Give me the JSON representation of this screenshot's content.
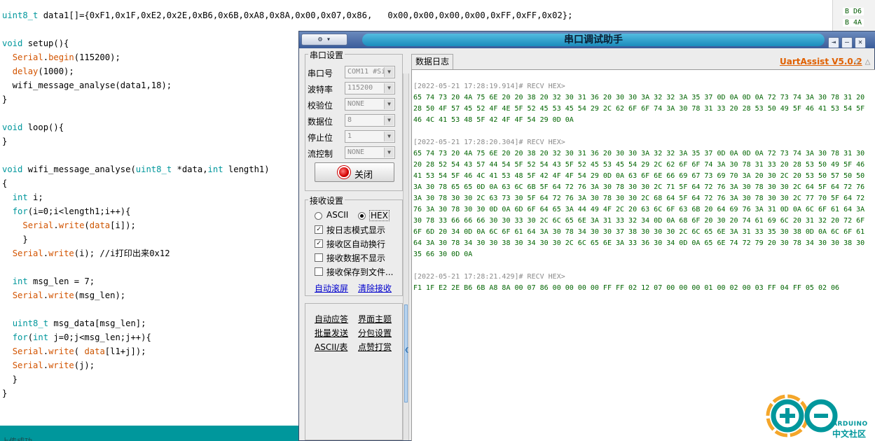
{
  "editor": {
    "top_line": "uint8_t data1[]={0xF1,0x1F,0xE2,0x2E,0xB6,0x6B,0xA8,0x8A,0x00,0x07,0x86,   0x00,0x00,0x00,0x00,0xFF,0xFF,0x02};",
    "lines": [
      "void setup(){",
      "  Serial.begin(115200);",
      "  delay(1000);",
      "  wifi_message_analyse(data1,18);",
      "}",
      "",
      "void loop(){",
      "}",
      "",
      "void wifi_message_analyse(uint8_t *data,int length1)",
      "{",
      "  int i;",
      "  for(i=0;i<length1;i++){",
      "    Serial.write(data[i]);",
      "    }",
      "  Serial.write(i); //i打印出来0x12",
      "",
      "  int msg_len = 7;",
      "  Serial.write(msg_len);",
      "",
      "  uint8_t msg_data[msg_len];",
      "  for(int j=0;j<msg_len;j++){",
      "  Serial.write( data[l1+j]);",
      "  Serial.write(j);",
      "  }",
      "}"
    ],
    "status_text": "上传成功",
    "hex_peek": [
      "B D6",
      "B 4A"
    ]
  },
  "uart": {
    "sys_menu": "⚙ ▾",
    "title": "串口调试助手",
    "title_buttons": [
      "⇥",
      "—",
      "✕"
    ],
    "port_group": "串口设置",
    "fields": [
      {
        "label": "串口号",
        "value": "COM11 #Si"
      },
      {
        "label": "波特率",
        "value": "115200"
      },
      {
        "label": "校验位",
        "value": "NONE"
      },
      {
        "label": "数据位",
        "value": "8"
      },
      {
        "label": "停止位",
        "value": "1"
      },
      {
        "label": "流控制",
        "value": "NONE"
      }
    ],
    "close_button": "关闭",
    "recv_group": "接收设置",
    "radio_ascii": "ASCII",
    "radio_hex": "HEX",
    "checks": [
      {
        "label": "按日志模式显示",
        "checked": true
      },
      {
        "label": "接收区自动换行",
        "checked": true
      },
      {
        "label": "接收数据不显示",
        "checked": false
      },
      {
        "label": "接收保存到文件...",
        "checked": false
      }
    ],
    "link_autoscroll": "自动滚屏",
    "link_clear": "清除接收",
    "more_links": [
      [
        "自动应答",
        "界面主题"
      ],
      [
        "批量发送",
        "分包设置"
      ],
      [
        "ASCII/表",
        "点赞打赏"
      ]
    ],
    "tab_label": "数据日志",
    "brand": "UartAssist V5.0.2",
    "log": [
      {
        "type": "hdr",
        "text": "[2022-05-21 17:28:19.914]# RECV HEX>"
      },
      {
        "type": "hex",
        "text": "65 74 73 20 4A 75 6E 20 20 38 20 32 30 31 36 20 30 30 3A 32 32 3A 35 37 0D 0A 0D 0A 72 73 74 3A 30 78 31 20"
      },
      {
        "type": "hex",
        "text": "28 50 4F 57 45 52 4F 4E 5F 52 45 53 45 54 29 2C 62 6F 6F 74 3A 30 78 31 33 20 28 53 50 49 5F 46 41 53 54 5F"
      },
      {
        "type": "hex",
        "text": "46 4C 41 53 48 5F 42 4F 4F 54 29 0D 0A"
      },
      {
        "type": "blank",
        "text": ""
      },
      {
        "type": "hdr",
        "text": "[2022-05-21 17:28:20.304]# RECV HEX>"
      },
      {
        "type": "hex",
        "text": "65 74 73 20 4A 75 6E 20 20 38 20 32 30 31 36 20 30 30 3A 32 32 3A 35 37 0D 0A 0D 0A 72 73 74 3A 30 78 31 30"
      },
      {
        "type": "hex",
        "text": "20 28 52 54 43 57 44 54 5F 52 54 43 5F 52 45 53 45 54 29 2C 62 6F 6F 74 3A 30 78 31 33 20 28 53 50 49 5F 46"
      },
      {
        "type": "hex",
        "text": "41 53 54 5F 46 4C 41 53 48 5F 42 4F 4F 54 29 0D 0A 63 6F 6E 66 69 67 73 69 70 3A 20 30 2C 20 53 50 57 50 50"
      },
      {
        "type": "hex",
        "text": "3A 30 78 65 65 0D 0A 63 6C 6B 5F 64 72 76 3A 30 78 30 30 2C 71 5F 64 72 76 3A 30 78 30 30 2C 64 5F 64 72 76"
      },
      {
        "type": "hex",
        "text": "3A 30 78 30 30 2C 63 73 30 5F 64 72 76 3A 30 78 30 30 2C 68 64 5F 64 72 76 3A 30 78 30 30 2C 77 70 5F 64 72"
      },
      {
        "type": "hex",
        "text": "76 3A 30 78 30 30 0D 0A 6D 6F 64 65 3A 44 49 4F 2C 20 63 6C 6F 63 6B 20 64 69 76 3A 31 0D 0A 6C 6F 61 64 3A"
      },
      {
        "type": "hex",
        "text": "30 78 33 66 66 66 30 30 33 30 2C 6C 65 6E 3A 31 33 32 34 0D 0A 68 6F 20 30 20 74 61 69 6C 20 31 32 20 72 6F"
      },
      {
        "type": "hex",
        "text": "6F 6D 20 34 0D 0A 6C 6F 61 64 3A 30 78 34 30 30 37 38 30 30 30 2C 6C 65 6E 3A 31 33 35 30 38 0D 0A 6C 6F 61"
      },
      {
        "type": "hex",
        "text": "64 3A 30 78 34 30 30 38 30 34 30 30 2C 6C 65 6E 3A 33 36 30 34 0D 0A 65 6E 74 72 79 20 30 78 34 30 30 38 30"
      },
      {
        "type": "hex",
        "text": "35 66 30 0D 0A"
      },
      {
        "type": "blank",
        "text": ""
      },
      {
        "type": "hdr",
        "text": "[2022-05-21 17:28:21.429]# RECV HEX>"
      },
      {
        "type": "hex",
        "text": "F1 1F E2 2E B6 6B A8 8A 00 07 86 00 00 00 00 FF FF 02 12 07 00 00 00 01 00 02 00 03 FF 04 FF 05 02 06"
      }
    ]
  },
  "watermark": {
    "line1": "ARDUINO",
    "line2": "中文社区"
  },
  "colors": {
    "arduino_teal": "#00979c",
    "log_green": "#006400",
    "brand_orange": "#e06000"
  }
}
